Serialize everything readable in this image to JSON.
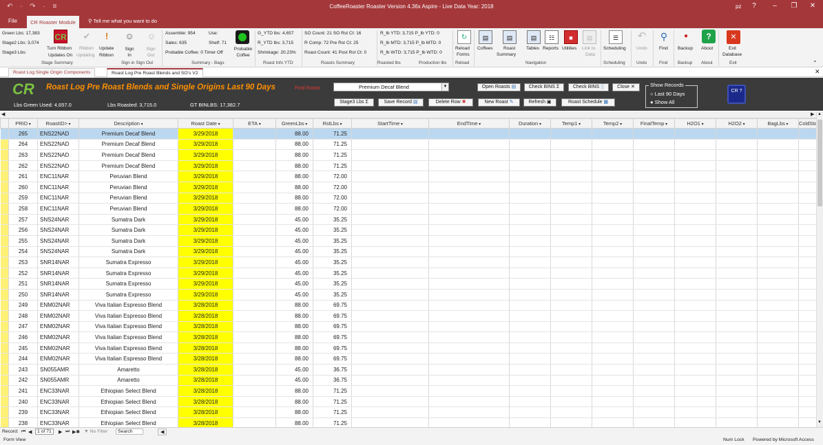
{
  "app": {
    "window_title": "CoffeeRoaster Roaster Version 4.36x Aspire  - Live Data  Year: 2018",
    "user_initials": "pz",
    "qat": "↶ · ↷ · ≡"
  },
  "menu": {
    "file": "File",
    "active_tab": "CR Roaster Module",
    "tell_me": "Tell me what you want to do"
  },
  "ribbon": {
    "stage_summary": {
      "green_lbs": "Green Lbs: 17,383",
      "stage2_lbs": "Stage2 Lbs:  3,074",
      "stage3_lbs": "Stage3 Lbs:",
      "label": "Stage Summary"
    },
    "turn_ribbon": "Turn Ribbon",
    "updates_on": "Updates On",
    "ribbon_updating": "Ribbon",
    "updating": "Updating",
    "update_ribbon": "Update",
    "ribbon_word": "Ribbon",
    "sign_in": "Sign In",
    "sign_out": "Sign Out",
    "sign_in_group": "Sign in  Sign Out",
    "summary_bags": {
      "assemble": "Assemble: 954",
      "use": "Use:",
      "sales": "Sales:  635",
      "shelf": "Shelf: 71",
      "probable": "Probable Coffee: 0 Timer Off",
      "probable_coffee_btn": "Probable Coffee",
      "label": "Summary - Bags"
    },
    "roast_info": {
      "g_ytd": "G_YTD lbs: 4,657",
      "r_ytd": "R_YTD lbs: 3,715",
      "shrinkage": "Shrinkage: 20.23%",
      "label": "Roast Info YTD"
    },
    "roasts_summary": {
      "so_count": "SO Count:   21  SO Rst Ct:  16",
      "r_comp": "R Comp: 72       Pre Rst Ct:  25",
      "roast_count": "Roast Count: 41 Post Rst Ct: 0",
      "label": "Roasts Summary"
    },
    "roasted_lbs": {
      "r_ytd": "R_lb YTD: 3,715  P_lb YTD:  0",
      "r_mtd": "R_lb MTD: 3,715 P_lb MTD: 0",
      "r_wtd": "R_lb WTD: 3,715 P_lb WTD: 0",
      "label": "Roasted lbs",
      "label2": "Production lbs"
    },
    "reload": {
      "line1": "Reload",
      "line2": "Forms",
      "label": "Reload"
    },
    "nav": {
      "coffees": "Coffees",
      "roast": "Roast",
      "summary": "Summary",
      "tables": "Tables",
      "reports": "Reports",
      "utilities": "Utilities",
      "link_to": "Link to",
      "data": "Data",
      "label": "Navigation"
    },
    "scheduling": "Scheduling",
    "undo": "Undo",
    "find": "Find",
    "backup": "Backup",
    "about": "About",
    "exit_db": {
      "line1": "Exit",
      "line2": "Database",
      "label": "Exit"
    }
  },
  "doc_tabs": [
    "Roast Log Single Origin Components",
    "Roast Log Pre Roast Blends and SO's V2"
  ],
  "header": {
    "logo": "CR",
    "title": "Roast Log Pre Roast Blends and Single Origins Last 90 Days",
    "find_roast_label": "Find Roast",
    "find_roast_value": "Premium Decaf Blend",
    "lbs_green_used": "Lbs Green Used:  4,657.0",
    "lbs_roasted": "Lbs Roasted:  3,715.0",
    "gt_binlbs": "GT BINLBS:  17,382.7",
    "buttons": {
      "open_roasts": "Open Roasts",
      "check_bins_sigma": "Check BINS Σ",
      "check_bins_chart": "Check BINS",
      "close": "Close ✕",
      "stage3_lbs": "Stage3 Lbs Σ",
      "save_record": "Save Record",
      "delete_row": "Delete Row",
      "new_roast": "New Roast",
      "refresh": "Refresh",
      "roast_schedule": "Roast Schedule"
    },
    "show_records": {
      "legend": "Show Records",
      "opt1": "Last 90 Days",
      "opt2": "Show All"
    },
    "help_badge": "CR ?"
  },
  "table": {
    "columns": [
      "PRID",
      "RoastID>",
      "Description",
      "Roast Date",
      "ETA",
      "GreenLbs",
      "RstLbs",
      "StartTime",
      "EndTime",
      "Duration",
      "Temp1",
      "Temp2",
      "FinalTemp",
      "H2O1",
      "H2O2",
      "BagLbs",
      "ColdStor"
    ],
    "rows": [
      [
        "265",
        "ENS22NAD",
        "Premium Decaf Blend",
        "3/29/2018",
        "88.00",
        "71.25"
      ],
      [
        "264",
        "ENS22NAD",
        "Premium Decaf Blend",
        "3/29/2018",
        "88.00",
        "71.25"
      ],
      [
        "263",
        "ENS22NAD",
        "Premium Decaf Blend",
        "3/29/2018",
        "88.00",
        "71.25"
      ],
      [
        "262",
        "ENS22NAD",
        "Premium Decaf Blend",
        "3/29/2018",
        "88.00",
        "71.25"
      ],
      [
        "261",
        "ENC11NAR",
        "Peruvian Blend",
        "3/29/2018",
        "88.00",
        "72.00"
      ],
      [
        "260",
        "ENC11NAR",
        "Peruvian Blend",
        "3/29/2018",
        "88.00",
        "72.00"
      ],
      [
        "259",
        "ENC11NAR",
        "Peruvian Blend",
        "3/29/2018",
        "88.00",
        "72.00"
      ],
      [
        "258",
        "ENC11NAR",
        "Peruvian Blend",
        "3/29/2018",
        "88.00",
        "72.00"
      ],
      [
        "257",
        "SNS24NAR",
        "Sumatra Dark",
        "3/29/2018",
        "45.00",
        "35.25"
      ],
      [
        "256",
        "SNS24NAR",
        "Sumatra Dark",
        "3/29/2018",
        "45.00",
        "35.25"
      ],
      [
        "255",
        "SNS24NAR",
        "Sumatra Dark",
        "3/29/2018",
        "45.00",
        "35.25"
      ],
      [
        "254",
        "SNS24NAR",
        "Sumatra Dark",
        "3/29/2018",
        "45.00",
        "35.25"
      ],
      [
        "253",
        "SNR14NAR",
        "Sumatra Expresso",
        "3/29/2018",
        "45.00",
        "35.25"
      ],
      [
        "252",
        "SNR14NAR",
        "Sumatra Expresso",
        "3/29/2018",
        "45.00",
        "35.25"
      ],
      [
        "251",
        "SNR14NAR",
        "Sumatra Expresso",
        "3/29/2018",
        "45.00",
        "35.25"
      ],
      [
        "250",
        "SNR14NAR",
        "Sumatra Expresso",
        "3/29/2018",
        "45.00",
        "35.25"
      ],
      [
        "249",
        "ENM02NAR",
        "Viva Italian Espresso Blend",
        "3/28/2018",
        "88.00",
        "69.75"
      ],
      [
        "248",
        "ENM02NAR",
        "Viva Italian Espresso Blend",
        "3/28/2018",
        "88.00",
        "69.75"
      ],
      [
        "247",
        "ENM02NAR",
        "Viva Italian Espresso Blend",
        "3/28/2018",
        "88.00",
        "69.75"
      ],
      [
        "246",
        "ENM02NAR",
        "Viva Italian Espresso Blend",
        "3/28/2018",
        "88.00",
        "69.75"
      ],
      [
        "245",
        "ENM02NAR",
        "Viva Italian Espresso Blend",
        "3/28/2018",
        "88.00",
        "69.75"
      ],
      [
        "244",
        "ENM02NAR",
        "Viva Italian Espresso Blend",
        "3/28/2018",
        "88.00",
        "69.75"
      ],
      [
        "243",
        "SN055AMR",
        "Amaretto",
        "3/28/2018",
        "45.00",
        "36.75"
      ],
      [
        "242",
        "SN055AMR",
        "Amaretto",
        "3/28/2018",
        "45.00",
        "36.75"
      ],
      [
        "241",
        "ENC33NAR",
        "Ethiopian Select Blend",
        "3/28/2018",
        "88.00",
        "71.25"
      ],
      [
        "240",
        "ENC33NAR",
        "Ethiopian Select Blend",
        "3/28/2018",
        "88.00",
        "71.25"
      ],
      [
        "239",
        "ENC33NAR",
        "Ethiopian Select Blend",
        "3/28/2018",
        "88.00",
        "71.25"
      ],
      [
        "238",
        "ENC33NAR",
        "Ethiopian Select Blend",
        "3/28/2018",
        "88.00",
        "71.25"
      ]
    ]
  },
  "record_nav": {
    "record_label": "Record:",
    "position": "1 of 71",
    "no_filter": "No Filter",
    "search": "Search"
  },
  "status": {
    "view": "Form View",
    "num_lock": "Num Lock",
    "powered": "Powered by Microsoft Access"
  },
  "colors": {
    "accent": "#a4373a",
    "header_bg": "#3b3b3b",
    "date_highlight": "#ffff00",
    "title_text": "#ff8f00",
    "logo_green": "#7cc242"
  }
}
